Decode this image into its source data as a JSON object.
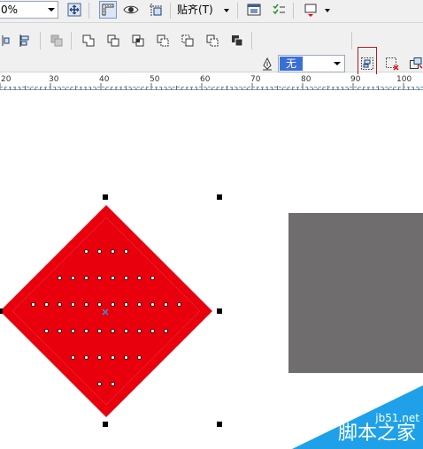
{
  "toolbar_top": {
    "zoom_value": "0%",
    "snap_label": "贴齐(T)"
  },
  "property_bar": {
    "outline_value": "无"
  },
  "ruler": {
    "labels": [
      "20",
      "30",
      "40",
      "50",
      "60",
      "70",
      "80",
      "90",
      "100"
    ]
  },
  "watermark": {
    "url": "jb51.net",
    "text": "脚本之家"
  },
  "colors": {
    "diamond_red": "#e8000d",
    "gray_rect": "#6f6d6e",
    "watermark_blue": "#1ea1e8"
  }
}
